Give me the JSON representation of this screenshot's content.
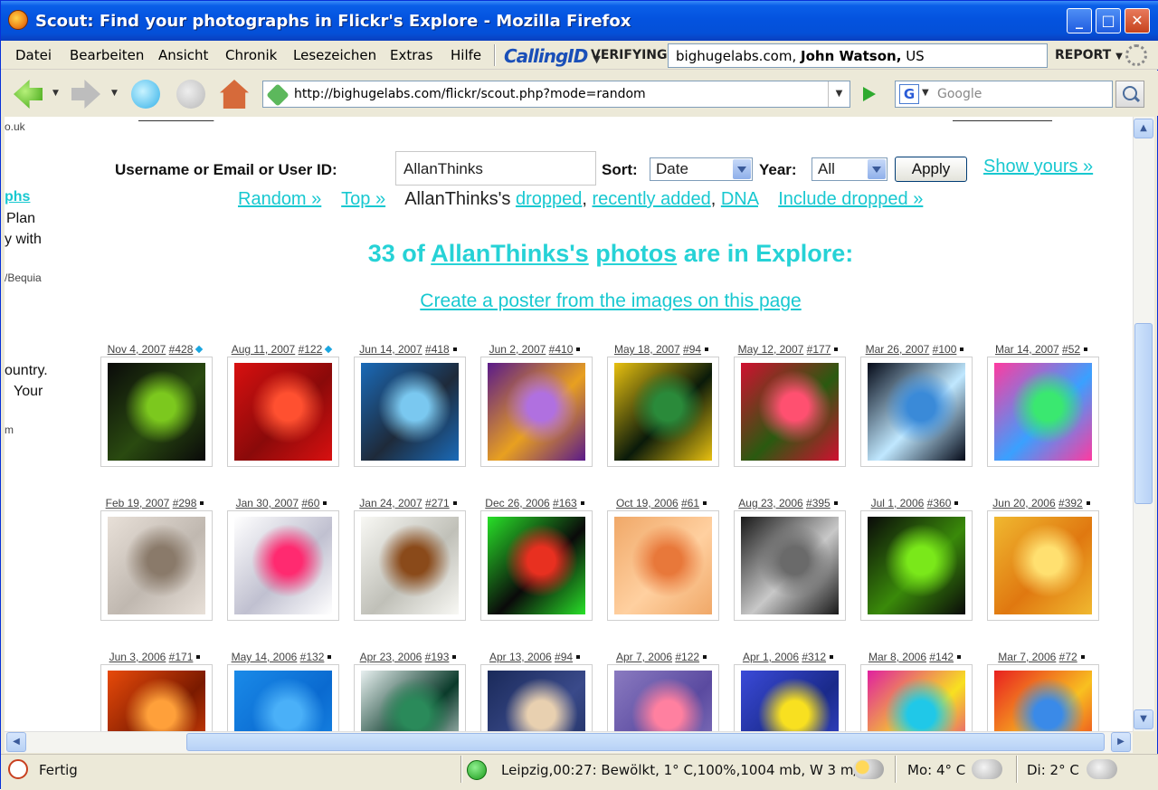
{
  "window": {
    "title": "Scout: Find your photographs in Flickr's Explore - Mozilla Firefox"
  },
  "menu": {
    "items": [
      "Datei",
      "Bearbeiten",
      "Ansicht",
      "Chronik",
      "Lesezeichen",
      "Extras",
      "Hilfe"
    ],
    "callingid": "CallingID",
    "verifying": "VERIFYING",
    "verify_site": "bighugelabs.com,",
    "verify_owner": "John Watson,",
    "verify_country": "US",
    "report": "REPORT"
  },
  "nav": {
    "url": "http://bighugelabs.com/flickr/scout.php?mode=random",
    "search_placeholder": "Google",
    "search_engine": "G"
  },
  "left_fragments": [
    {
      "text": "o.uk",
      "style": "small"
    },
    {
      "text": "phs",
      "style": "link"
    },
    {
      "text": "Plan",
      "style": "normal"
    },
    {
      "text": "y with",
      "style": "normal"
    },
    {
      "text": "/Bequia",
      "style": "small"
    },
    {
      "text": "ountry.",
      "style": "normal"
    },
    {
      "text": "Your",
      "style": "normal"
    },
    {
      "text": "m",
      "style": "small"
    }
  ],
  "form": {
    "user_label": "Username or Email or User ID:",
    "user_value": "AllanThinks",
    "sort_label": "Sort:",
    "sort_value": "Date",
    "year_label": "Year:",
    "year_value": "All",
    "apply_label": "Apply",
    "show_yours": "Show yours »"
  },
  "subnav": {
    "random": "Random »",
    "top": "Top »",
    "user_prefix": "AllanThinks's",
    "dropped": "dropped",
    "comma1": ",",
    "recently_added": "recently added",
    "comma2": ",",
    "dna": "DNA",
    "include_dropped": "Include dropped »"
  },
  "heading": {
    "count_prefix": "33 of",
    "user_link": "AllanThinks's",
    "photos_link": "photos",
    "suffix": "are in Explore:"
  },
  "poster_link": "Create a poster from the images on this page",
  "photos": [
    {
      "date": "Nov 4, 2007",
      "rank": "#428",
      "marker": "blue",
      "colors": [
        "#0a0a0a",
        "#7cc81e",
        "#2a4a10"
      ]
    },
    {
      "date": "Aug 11, 2007",
      "rank": "#122",
      "marker": "blue",
      "colors": [
        "#d81010",
        "#ff5030",
        "#8a0a0a"
      ]
    },
    {
      "date": "Jun 14, 2007",
      "rank": "#418",
      "marker": "black",
      "colors": [
        "#1a6ab8",
        "#7ac8f0",
        "#1e2a3a"
      ]
    },
    {
      "date": "Jun 2, 2007",
      "rank": "#410",
      "marker": "black",
      "colors": [
        "#5a1a8a",
        "#b070e0",
        "#e8a020"
      ]
    },
    {
      "date": "May 18, 2007",
      "rank": "#94",
      "marker": "black",
      "colors": [
        "#e8c010",
        "#2a8a3a",
        "#0a1a0a"
      ]
    },
    {
      "date": "May 12, 2007",
      "rank": "#177",
      "marker": "black",
      "colors": [
        "#d01030",
        "#ff5070",
        "#2a5a10"
      ]
    },
    {
      "date": "Mar 26, 2007",
      "rank": "#100",
      "marker": "black",
      "colors": [
        "#050a18",
        "#3a8ad8",
        "#c0e8ff"
      ]
    },
    {
      "date": "Mar 14, 2007",
      "rank": "#52",
      "marker": "black",
      "colors": [
        "#ff3aa0",
        "#3ae870",
        "#3aa0ff"
      ]
    },
    {
      "date": "Feb 19, 2007",
      "rank": "#298",
      "marker": "black",
      "colors": [
        "#e8e0d8",
        "#8a7a6a",
        "#c0b8b0"
      ]
    },
    {
      "date": "Jan 30, 2007",
      "rank": "#60",
      "marker": "black",
      "colors": [
        "#ffffff",
        "#ff2a70",
        "#c0c0d0"
      ]
    },
    {
      "date": "Jan 24, 2007",
      "rank": "#271",
      "marker": "black",
      "colors": [
        "#f8f8f4",
        "#8a4a1a",
        "#c0c0b8"
      ]
    },
    {
      "date": "Dec 26, 2006",
      "rank": "#163",
      "marker": "black",
      "colors": [
        "#28e028",
        "#e83020",
        "#0a0a0a"
      ]
    },
    {
      "date": "Oct 19, 2006",
      "rank": "#61",
      "marker": "black",
      "colors": [
        "#f0a868",
        "#e8783a",
        "#ffd0a0"
      ]
    },
    {
      "date": "Aug 23, 2006",
      "rank": "#395",
      "marker": "black",
      "colors": [
        "#1a1a1a",
        "#6a6a6a",
        "#c8c8c8"
      ]
    },
    {
      "date": "Jul 1, 2006",
      "rank": "#360",
      "marker": "black",
      "colors": [
        "#0a0a0a",
        "#7ae81a",
        "#3a8a0a"
      ]
    },
    {
      "date": "Jun 20, 2006",
      "rank": "#392",
      "marker": "black",
      "colors": [
        "#f0b830",
        "#ffe070",
        "#e07810"
      ]
    },
    {
      "date": "Jun 3, 2006",
      "rank": "#171",
      "marker": "black",
      "colors": [
        "#e84a0a",
        "#ffa03a",
        "#7a1a00"
      ]
    },
    {
      "date": "May 14, 2006",
      "rank": "#132",
      "marker": "black",
      "colors": [
        "#1a8ae8",
        "#4ab0f8",
        "#0a6ad0"
      ]
    },
    {
      "date": "Apr 23, 2006",
      "rank": "#193",
      "marker": "black",
      "colors": [
        "#e8f0f0",
        "#2a8a5a",
        "#0a3a2a"
      ]
    },
    {
      "date": "Apr 13, 2006",
      "rank": "#94",
      "marker": "black",
      "colors": [
        "#1a2a5a",
        "#e8d0b0",
        "#3a4a8a"
      ]
    },
    {
      "date": "Apr 7, 2006",
      "rank": "#122",
      "marker": "black",
      "colors": [
        "#8a7ac0",
        "#ff80a0",
        "#5a4aa0"
      ]
    },
    {
      "date": "Apr 1, 2006",
      "rank": "#312",
      "marker": "black",
      "colors": [
        "#3a4ad8",
        "#f8e020",
        "#1a2a8a"
      ]
    },
    {
      "date": "Mar 8, 2006",
      "rank": "#142",
      "marker": "black",
      "colors": [
        "#e020a0",
        "#20c8e8",
        "#f8e020"
      ]
    },
    {
      "date": "Mar 7, 2006",
      "rank": "#72",
      "marker": "black",
      "colors": [
        "#e82020",
        "#3a8ae8",
        "#f8c020"
      ]
    }
  ],
  "status": {
    "text": "Fertig",
    "weather": "Leipzig,00:27: Bewölkt, 1° C,100%,1004 mb, W 3 m/s",
    "forecast1": "Mo: 4° C",
    "forecast2": "Di: 2° C"
  }
}
